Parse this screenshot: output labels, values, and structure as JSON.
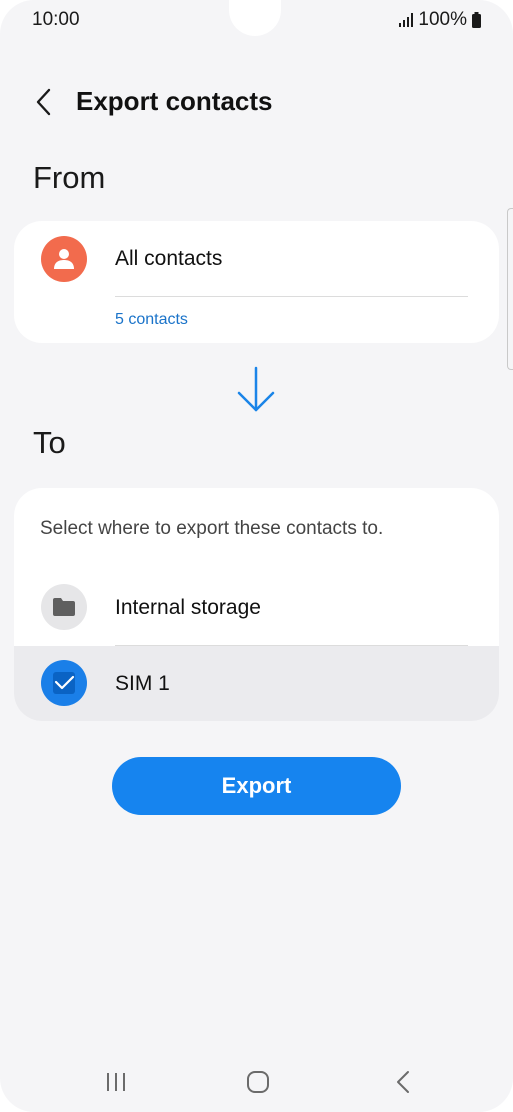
{
  "status_bar": {
    "time": "10:00",
    "battery": "100%"
  },
  "header": {
    "title": "Export contacts",
    "back_icon": "chevron-left-icon"
  },
  "from_section": {
    "label": "From",
    "source": {
      "title": "All contacts",
      "count": "5 contacts",
      "icon": "person-icon",
      "icon_color": "#f26b4d"
    }
  },
  "to_section": {
    "label": "To",
    "hint": "Select where to export these contacts to.",
    "options": [
      {
        "label": "Internal storage",
        "icon": "folder-icon",
        "selected": false
      },
      {
        "label": "SIM 1",
        "icon": "sim-card-icon",
        "selected": true
      }
    ]
  },
  "actions": {
    "export_label": "Export"
  },
  "colors": {
    "accent": "#1684ef",
    "link": "#1a73c9",
    "background": "#f5f5f7",
    "selected_row": "#ebebee"
  },
  "nav_bar": {
    "recents_icon": "recents-icon",
    "home_icon": "home-icon",
    "back_icon": "back-icon"
  }
}
